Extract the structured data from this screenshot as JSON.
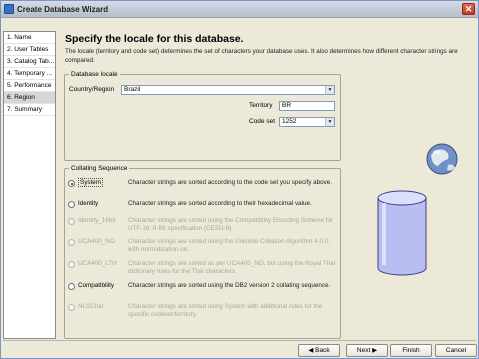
{
  "window": {
    "title": "Create Database Wizard",
    "close_symbol": "✕"
  },
  "steps": [
    {
      "label": "1. Name",
      "active": false
    },
    {
      "label": "2. User Tables",
      "active": false
    },
    {
      "label": "3. Catalog Tab...",
      "active": false
    },
    {
      "label": "4. Temporary ...",
      "active": false
    },
    {
      "label": "5. Performance",
      "active": false
    },
    {
      "label": "6. Region",
      "active": true
    },
    {
      "label": "7. Summary",
      "active": false
    }
  ],
  "main": {
    "heading": "Specify the locale for this database.",
    "description": "The locale (territory and code set) determines the set of characters your database uses. It also determines how different character strings are compared."
  },
  "locale": {
    "legend": "Database locale",
    "country_label": "Country/Region",
    "country_value": "Brazil",
    "territory_label": "Territory",
    "territory_value": "BR",
    "codeset_label": "Code set",
    "codeset_value": "1252"
  },
  "collating": {
    "legend": "Collating Sequence",
    "options": [
      {
        "label": "System",
        "desc": "Character strings are sorted according to the code set you specify above.",
        "checked": true,
        "disabled": false
      },
      {
        "label": "Identity",
        "desc": "Character strings are sorted according to their hexadecimal value.",
        "checked": false,
        "disabled": false
      },
      {
        "label": "Identity_16bit",
        "desc": "Character strings are sorted using the Compatibility Encoding Scheme for UTF-16: 8-Bit specification (CESU-8).",
        "checked": false,
        "disabled": true
      },
      {
        "label": "UCA400_NO",
        "desc": "Character strings are sorted using the Unicode Collation Algorithm 4.0.0, with normalization on.",
        "checked": false,
        "disabled": true
      },
      {
        "label": "UCA400_LTH",
        "desc": "Character strings are sorted as per UCA400_NO, but using the Royal Thai dictionary rules for the Thai characters.",
        "checked": false,
        "disabled": true
      },
      {
        "label": "Compatibility",
        "desc": "Character strings are sorted using the DB2 version 2 collating sequence.",
        "checked": false,
        "disabled": false
      },
      {
        "label": "NLSChar",
        "desc": "Character strings are sorted using System with additional rules for the specific codeset/territory.",
        "checked": false,
        "disabled": true
      }
    ]
  },
  "footer": {
    "back_label": "◀ Back",
    "next_label": "Next ▶",
    "finish_label": "Finish",
    "cancel_label": "Cancel"
  },
  "colors": {
    "disabled_text": "#a9a79e",
    "accent": "#3a6fc4"
  },
  "icons": [
    "database-icon",
    "globe-icon",
    "close-icon",
    "dropdown-arrow-icon"
  ]
}
